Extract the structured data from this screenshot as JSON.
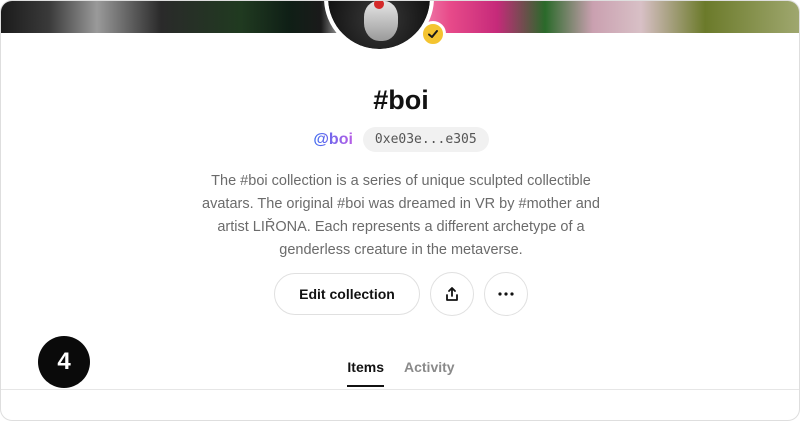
{
  "collection": {
    "title": "#boi",
    "creator_handle": "@boi",
    "address": "0xe03e...e305",
    "description_lines": [
      "The #boi collection is a series of unique sculpted collectible",
      "avatars. The original #boi was dreamed in VR by #mother and",
      "artist LIŘONA. Each represents a different archetype of a",
      "genderless creature in the metaverse."
    ]
  },
  "actions": {
    "edit_label": "Edit collection",
    "share_icon": "share-icon",
    "more_icon": "more-icon"
  },
  "badge": {
    "step_number": "4"
  },
  "tabs": [
    {
      "label": "Items",
      "active": true
    },
    {
      "label": "Activity",
      "active": false
    }
  ],
  "colors": {
    "verified": "#f4c430",
    "handle_gradient_start": "#3f6df0",
    "handle_gradient_end": "#b95ee6",
    "text_primary": "#121212",
    "text_muted": "#6b6b6b"
  }
}
